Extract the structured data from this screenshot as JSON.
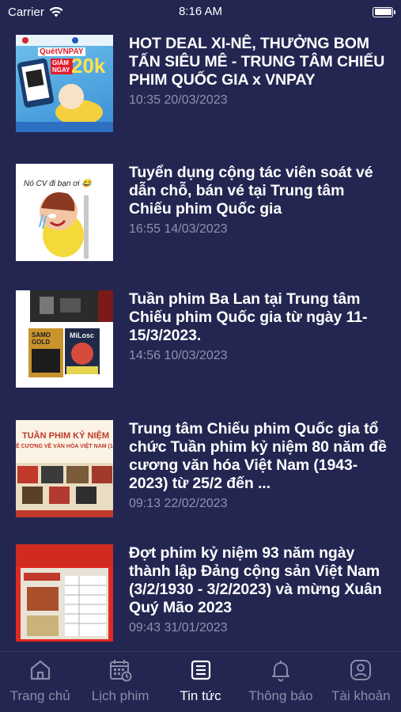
{
  "status": {
    "carrier": "Carrier",
    "time": "8:16 AM"
  },
  "news": [
    {
      "title": "HOT DEAL XI-NÊ, THƯỞNG BOM TẤN SIÊU MÊ - TRUNG TÂM CHIẾU PHIM QUỐC GIA x VNPAY",
      "date": "10:35 20/03/2023",
      "thumb": {
        "brand": "QuétVNPAY",
        "promo": "GIẢM NGAY",
        "amount": "20k"
      }
    },
    {
      "title": "Tuyển dụng cộng tác viên soát vé dẫn chỗ, bán vé tại Trung tâm Chiếu phim Quốc gia",
      "date": "16:55 14/03/2023",
      "thumb": {
        "caption": "Nó CV đi bạn ơi 😂"
      }
    },
    {
      "title": "Tuần phim Ba Lan tại Trung tâm Chiếu phim Quốc gia từ ngày 11-15/3/2023.",
      "date": "14:56 10/03/2023",
      "thumb": {
        "poster1": "SAMO GOLD",
        "poster2": "MiLosc"
      }
    },
    {
      "title": "Trung tâm Chiếu phim Quốc gia tổ chức Tuần phim kỷ niệm 80 năm đề cương văn hóa Việt Nam (1943-2023) từ 25/2 đến ...",
      "date": "09:13 22/02/2023",
      "thumb": {
        "heading": "TUẦN PHIM KỶ NIỆM",
        "sub": "Ề CƯƠNG VỀ VĂN HÓA VIỆT NAM (1"
      }
    },
    {
      "title": "Đợt phim kỷ niệm 93 năm ngày thành lập Đảng cộng sản Việt Nam (3/2/1930 - 3/2/2023) và mừng Xuân Quý Mão 2023",
      "date": "09:43 31/01/2023",
      "thumb": {}
    }
  ],
  "tabs": [
    {
      "label": "Trang chủ",
      "icon": "home-icon"
    },
    {
      "label": "Lịch phim",
      "icon": "calendar-icon"
    },
    {
      "label": "Tin tức",
      "icon": "news-icon",
      "active": true
    },
    {
      "label": "Thông báo",
      "icon": "bell-icon"
    },
    {
      "label": "Tài khoản",
      "icon": "account-icon"
    }
  ],
  "colors": {
    "background": "#232651",
    "date": "#8f92ad",
    "tab_inactive": "#8a8ca8",
    "tab_active": "#ffffff"
  }
}
